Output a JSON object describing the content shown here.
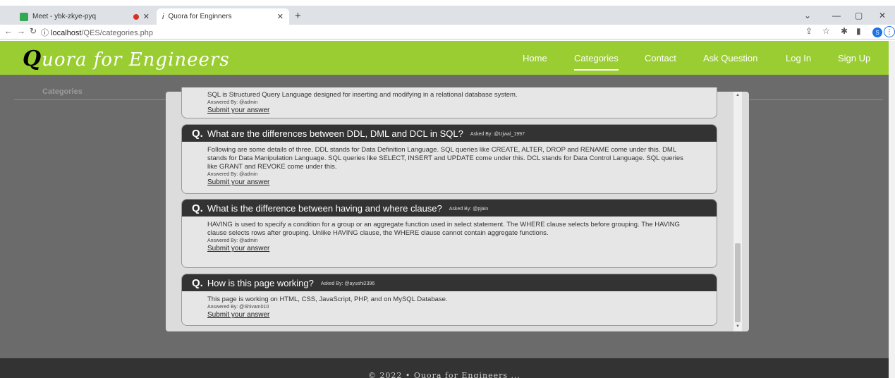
{
  "browser": {
    "tabs": [
      {
        "title": "Meet - ybk-zkye-pyq",
        "active": false
      },
      {
        "title": "Quora for Enginners",
        "active": true
      }
    ],
    "new_tab": "+",
    "url_host": "localhost",
    "url_path": "/QES/categories.php",
    "info_icon": "ⓘ",
    "profile_letter": "S"
  },
  "site": {
    "brand_initial": "Q",
    "brand_rest": "uora for Engineers",
    "nav": [
      {
        "label": "Home",
        "active": false
      },
      {
        "label": "Categories",
        "active": true
      },
      {
        "label": "Contact",
        "active": false
      },
      {
        "label": "Ask Question",
        "active": false
      },
      {
        "label": "Log In",
        "active": false
      },
      {
        "label": "Sign Up",
        "active": false
      }
    ],
    "page_label": "Categories",
    "footer": "© 2022 • Quora for Engineers ..."
  },
  "modal": {
    "partial_answer": "SQL is Structured Query Language designed for inserting and modifying in a relational database system.",
    "partial_answered_by": "Answered By: @admin",
    "submit_label": "Submit your answer",
    "qmark": "Q.",
    "questions": [
      {
        "title": "What are the differences between DDL, DML and DCL in SQL?",
        "asked_by": "Asked By: @Ujwal_1997",
        "answer": "Following are some details of three. DDL stands for Data Definition Language. SQL queries like CREATE, ALTER, DROP and RENAME come under this. DML stands for Data Manipulation Language. SQL queries like SELECT, INSERT and UPDATE come under this. DCL stands for Data Control Language. SQL queries like GRANT and REVOKE come under this.",
        "answered_by": "Answered By: @admin"
      },
      {
        "title": "What is the difference between having and where clause?",
        "asked_by": "Asked By: @pjain",
        "answer": "HAVING is used to specify a condition for a group or an aggregate function used in select statement. The WHERE clause selects before grouping. The HAVING clause selects rows after grouping. Unlike HAVING clause, the WHERE clause cannot contain aggregate functions.",
        "answered_by": "Answered By: @admin"
      },
      {
        "title": "How is this page working?",
        "asked_by": "Asked By: @ayushi2396",
        "answer": "This page is working on HTML, CSS, JavaScript, PHP, and on MySQL Database.",
        "answered_by": "Answered By: @Shivam010"
      }
    ]
  }
}
